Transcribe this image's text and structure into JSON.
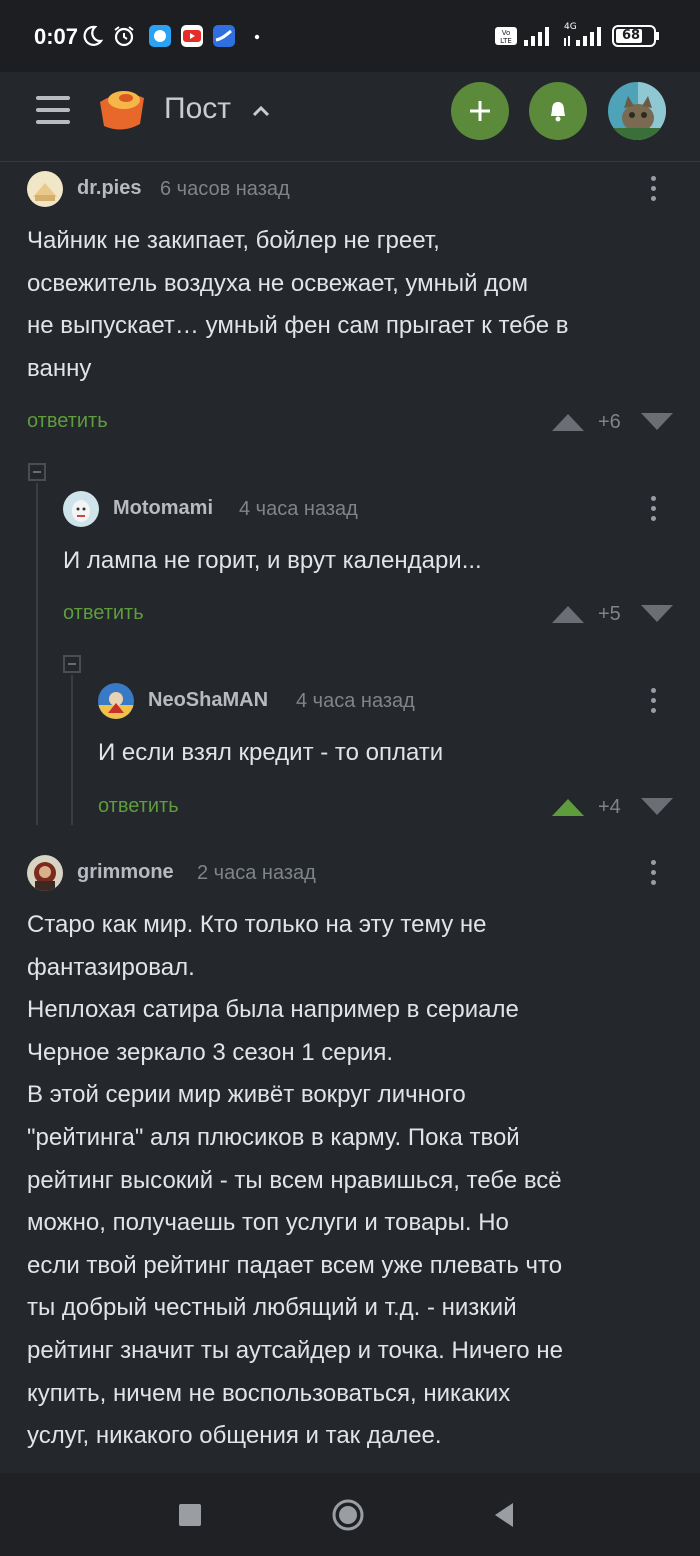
{
  "status_bar": {
    "time": "0:07",
    "battery": "68",
    "network": "4G"
  },
  "header": {
    "title": "Пост"
  },
  "comments": [
    {
      "author": "dr.pies",
      "time": "6 часов назад",
      "text_lines": [
        "Чайник не закипает, бойлер не греет,",
        "освежитель воздуха не освежает, умный дом",
        "не выпускает… умный фен сам прыгает к тебе в",
        "ванну"
      ],
      "reply_label": "ответить",
      "score": "+6"
    },
    {
      "author": "Motomami",
      "time": "4 часа назад",
      "text_lines": [
        "И лампа не горит, и врут календари..."
      ],
      "reply_label": "ответить",
      "score": "+5"
    },
    {
      "author": "NeoShaMAN",
      "time": "4 часа назад",
      "text_lines": [
        "И если взял кредит - то оплати"
      ],
      "reply_label": "ответить",
      "score": "+4",
      "upvoted": true
    },
    {
      "author": "grimmone",
      "time": "2 часа назад",
      "text_lines": [
        "Старо как мир. Кто только на эту тему не",
        "фантазировал.",
        "Неплохая сатира была например в сериале",
        "Черное зеркало 3 сезон 1 серия.",
        "В этой серии мир живёт вокруг личного",
        "\"рейтинга\" аля плюсиков в карму. Пока твой",
        "рейтинг высокий - ты всем нравишься, тебе всё",
        "можно, получаешь топ услуги и товары. Но",
        "если твой рейтинг падает всем уже плевать что",
        "ты добрый честный любящий и т.д. - низкий",
        "рейтинг значит ты аутсайдер и точка. Ничего не",
        "купить, ничем не воспользоваться, никаких",
        "услуг, никакого общения и так далее."
      ]
    }
  ],
  "colors": {
    "background": "#24272c",
    "accent_green": "#5a8a3a",
    "reply_green": "#5e9c3c"
  }
}
